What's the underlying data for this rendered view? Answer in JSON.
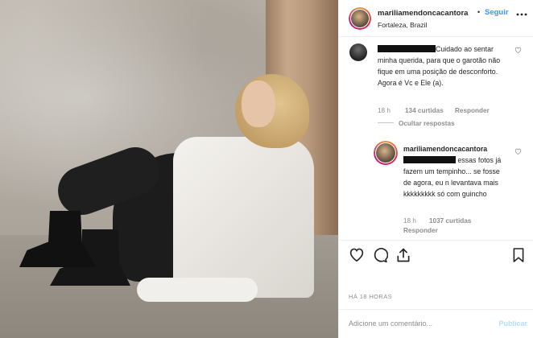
{
  "post": {
    "username": "mariliamendoncacantora",
    "dot": "•",
    "follow_label": "Seguir",
    "location": "Fortaleza, Brazil",
    "more_icon": "more-horizontal-icon"
  },
  "comment1": {
    "text": "Cuidado ao sentar minha querida, para que o garotão não fique em uma posição de desconforto. Agora é Vc e Ele (a).",
    "time": "18 h",
    "likes": "134 curtidas",
    "reply_label": "Responder",
    "hide_replies_label": "Ocultar respostas"
  },
  "reply": {
    "username": "mariliamendoncacantora",
    "text": "essas fotos já fazem um tempinho... se fosse de agora, eu n levantava mais kkkkkkkkk só com guincho",
    "time": "18 h",
    "likes": "1037 curtidas",
    "reply_label": "Responder"
  },
  "actions": {
    "like_icon": "heart-icon",
    "comment_icon": "comment-icon",
    "share_icon": "share-icon",
    "save_icon": "bookmark-icon"
  },
  "timestamp": "HÁ 18 HORAS",
  "add_comment": {
    "placeholder": "Adicione um comentário...",
    "publish_label": "Publicar"
  },
  "colors": {
    "link_blue": "#3897f0",
    "publish_disabled": "#b2dffc",
    "muted": "#8e8e8e"
  }
}
